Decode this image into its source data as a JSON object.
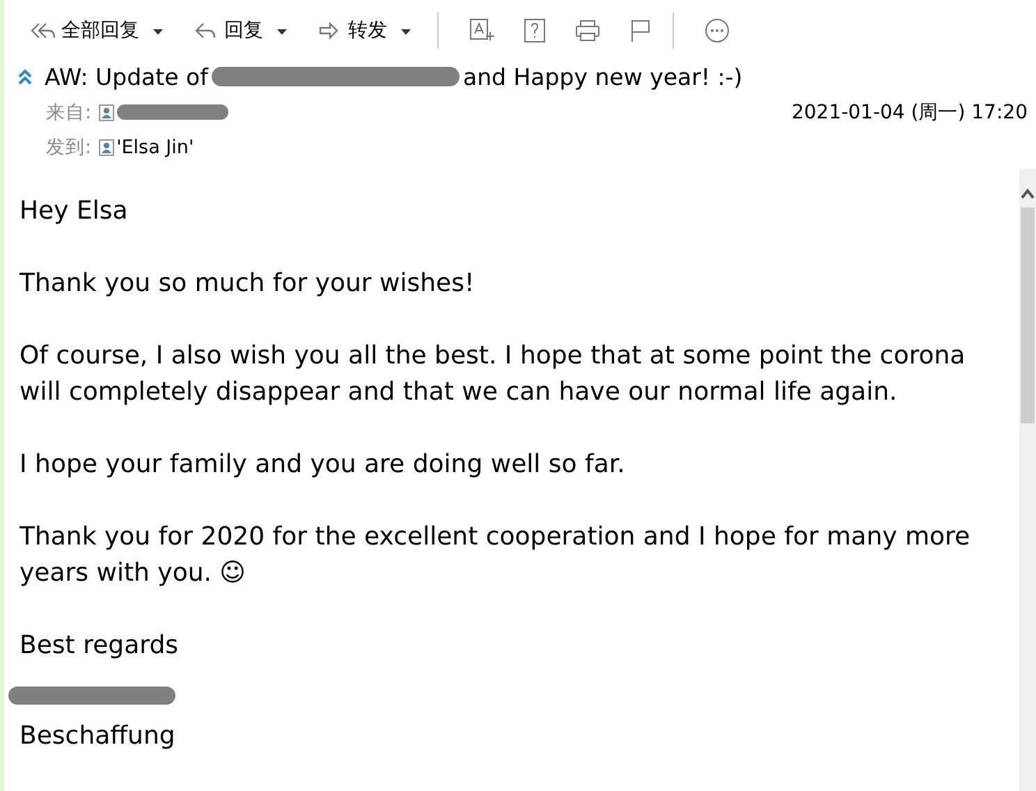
{
  "toolbar": {
    "buttons": [
      {
        "label": "全部回复",
        "kind": "reply-all",
        "dropdown": true
      },
      {
        "label": "回复",
        "kind": "reply",
        "dropdown": true
      },
      {
        "label": "转发",
        "kind": "forward",
        "dropdown": true
      }
    ],
    "icons": [
      {
        "kind": "translate"
      },
      {
        "kind": "help"
      },
      {
        "kind": "print"
      },
      {
        "kind": "flag"
      },
      {
        "kind": "more"
      }
    ]
  },
  "message": {
    "subject_start": "AW: Update of",
    "subject_end": "and Happy new year! :-)",
    "from_label": "来自:",
    "date": "2021-01-04 (周一) 17:20",
    "to_label": "发到:",
    "to": "'Elsa Jin'"
  },
  "body": {
    "paragraphs": [
      "Hey Elsa",
      "Thank you so much for your wishes!",
      "Of course, I also wish you all the best. I hope that at some point the corona will completely disappear and that we can have our normal life again.",
      "I hope your family and you are doing well so far.",
      "Thank you for 2020 for the excellent cooperation and I hope for many more years with you. ☺",
      "Best regards"
    ],
    "signature": "Beschaffung"
  }
}
